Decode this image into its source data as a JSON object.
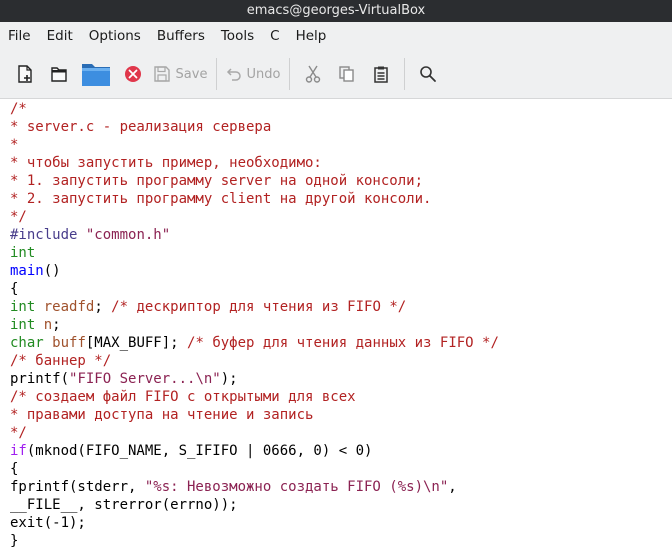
{
  "window": {
    "title": "emacs@georges-VirtualBox"
  },
  "menubar": [
    "File",
    "Edit",
    "Options",
    "Buffers",
    "Tools",
    "C",
    "Help"
  ],
  "toolbar": {
    "new_file": "new-file-icon",
    "open_dir": "open-directory-icon",
    "open_folder": "folder-icon",
    "close": "close-buffer-icon",
    "save_label": "Save",
    "undo_label": "Undo",
    "cut": "cut-icon",
    "copy": "copy-icon",
    "paste": "paste-icon",
    "search": "search-icon"
  },
  "colors": {
    "comment": "#b22222",
    "preprocessor": "#483d8b",
    "type": "#228b22",
    "function": "#0000ff",
    "variable": "#a0522d",
    "string": "#8b2252",
    "keyword": "#a020f0"
  },
  "code_lines": [
    [
      [
        "comment",
        "/*"
      ]
    ],
    [
      [
        "comment",
        "* server.c - реализация сервера"
      ]
    ],
    [
      [
        "comment",
        "*"
      ]
    ],
    [
      [
        "comment",
        "* чтобы запустить пример, необходимо:"
      ]
    ],
    [
      [
        "comment",
        "* 1. запустить программу server на одной консоли;"
      ]
    ],
    [
      [
        "comment",
        "* 2. запустить программу client на другой консоли."
      ]
    ],
    [
      [
        "comment",
        "*/"
      ]
    ],
    [
      [
        "pre",
        "#include"
      ],
      [
        "plain",
        " "
      ],
      [
        "str",
        "\"common.h\""
      ]
    ],
    [
      [
        "type",
        "int"
      ]
    ],
    [
      [
        "func",
        "main"
      ],
      [
        "plain",
        "()"
      ]
    ],
    [
      [
        "plain",
        "{"
      ]
    ],
    [
      [
        "type",
        "int"
      ],
      [
        "plain",
        " "
      ],
      [
        "var",
        "readfd"
      ],
      [
        "plain",
        "; "
      ],
      [
        "comment",
        "/* дескриптор для чтения из FIFO */"
      ]
    ],
    [
      [
        "type",
        "int"
      ],
      [
        "plain",
        " "
      ],
      [
        "var",
        "n"
      ],
      [
        "plain",
        ";"
      ]
    ],
    [
      [
        "type",
        "char"
      ],
      [
        "plain",
        " "
      ],
      [
        "var",
        "buff"
      ],
      [
        "plain",
        "[MAX_BUFF]; "
      ],
      [
        "comment",
        "/* буфер для чтения данных из FIFO */"
      ]
    ],
    [
      [
        "comment",
        "/* баннер */"
      ]
    ],
    [
      [
        "plain",
        "printf("
      ],
      [
        "str",
        "\"FIFO Server...\\n\""
      ],
      [
        "plain",
        ");"
      ]
    ],
    [
      [
        "comment",
        "/* создаем файл FIFO с открытыми для всех"
      ]
    ],
    [
      [
        "comment",
        "* правами доступа на чтение и запись"
      ]
    ],
    [
      [
        "comment",
        "*/"
      ]
    ],
    [
      [
        "kw",
        "if"
      ],
      [
        "plain",
        "(mknod(FIFO_NAME, S_IFIFO | 0666, 0) < 0)"
      ]
    ],
    [
      [
        "plain",
        "{"
      ]
    ],
    [
      [
        "plain",
        "fprintf(stderr, "
      ],
      [
        "str",
        "\"%s: Невозможно создать FIFO (%s)\\n\""
      ],
      [
        "plain",
        ","
      ]
    ],
    [
      [
        "plain",
        "__FILE__, strerror(errno));"
      ]
    ],
    [
      [
        "plain",
        "exit(-1);"
      ]
    ],
    [
      [
        "plain",
        "}"
      ]
    ]
  ]
}
